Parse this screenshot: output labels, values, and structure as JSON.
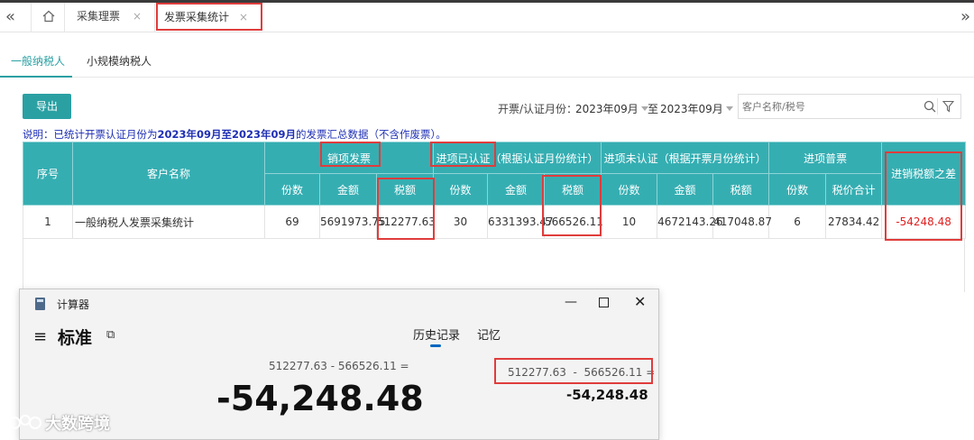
{
  "tabs": {
    "nav_left": "«",
    "nav_right": "»",
    "home_icon": "home-icon",
    "items": [
      {
        "label": "采集理票",
        "close": "×"
      },
      {
        "label": "发票采集统计",
        "close": "×"
      }
    ]
  },
  "subtabs": [
    "一般纳税人",
    "小规模纳税人"
  ],
  "toolbar": {
    "export_label": "导出",
    "period_label": "开票/认证月份：",
    "period_from": "2023年09月",
    "period_to_word": "至",
    "period_to": "2023年09月",
    "search_placeholder": "客户名称/税号"
  },
  "note": {
    "prefix": "说明：已统计开票认证月份为",
    "range": "2023年09月至2023年09月",
    "suffix": "的发票汇总数据（不含作废票）。"
  },
  "table": {
    "headers": {
      "seq": "序号",
      "customer": "客户名称",
      "sales": "销项发票",
      "input_certified": "进项已认证（根据认证月份统计）",
      "input_uncertified": "进项未认证（根据开票月份统计）",
      "input_ordinary": "进项普票",
      "diff": "进销税额之差"
    },
    "subheaders": {
      "sales": [
        "份数",
        "金额",
        "税额"
      ],
      "input_certified": [
        "份数",
        "金额",
        "税额"
      ],
      "input_uncertified": [
        "份数",
        "金额",
        "税额"
      ],
      "input_ordinary": [
        "份数",
        "税价合计"
      ]
    },
    "rows": [
      {
        "seq": "1",
        "customer": "一般纳税人发票采集统计",
        "sales_count": "69",
        "sales_amount": "5691973.75",
        "sales_tax": "512277.63",
        "cert_count": "30",
        "cert_amount": "6331393.47",
        "cert_tax": "566526.11",
        "uncert_count": "10",
        "uncert_amount": "4672143.26",
        "uncert_tax": "417048.87",
        "ord_count": "6",
        "ord_total": "27834.42",
        "diff": "-54248.48"
      }
    ]
  },
  "calculator": {
    "title": "计算器",
    "min": "—",
    "close": "✕",
    "menu_icon": "≡",
    "mode": "标准",
    "keep_on_top_icon": "⧉",
    "history_tab": "历史记录",
    "memory_tab": "记忆",
    "expression": "512277.63 - 566526.11 =",
    "result": "-54,248.48",
    "history_expression": "512277.63  -  566526.11 =",
    "history_result": "-54,248.48"
  },
  "watermark": "大数跨境",
  "colors": {
    "accent": "#2aa0a3",
    "header_bg": "#35aeb2",
    "highlight_box": "#e03c3c",
    "note_text": "#1e2fb4",
    "diff_text": "#e02020"
  }
}
